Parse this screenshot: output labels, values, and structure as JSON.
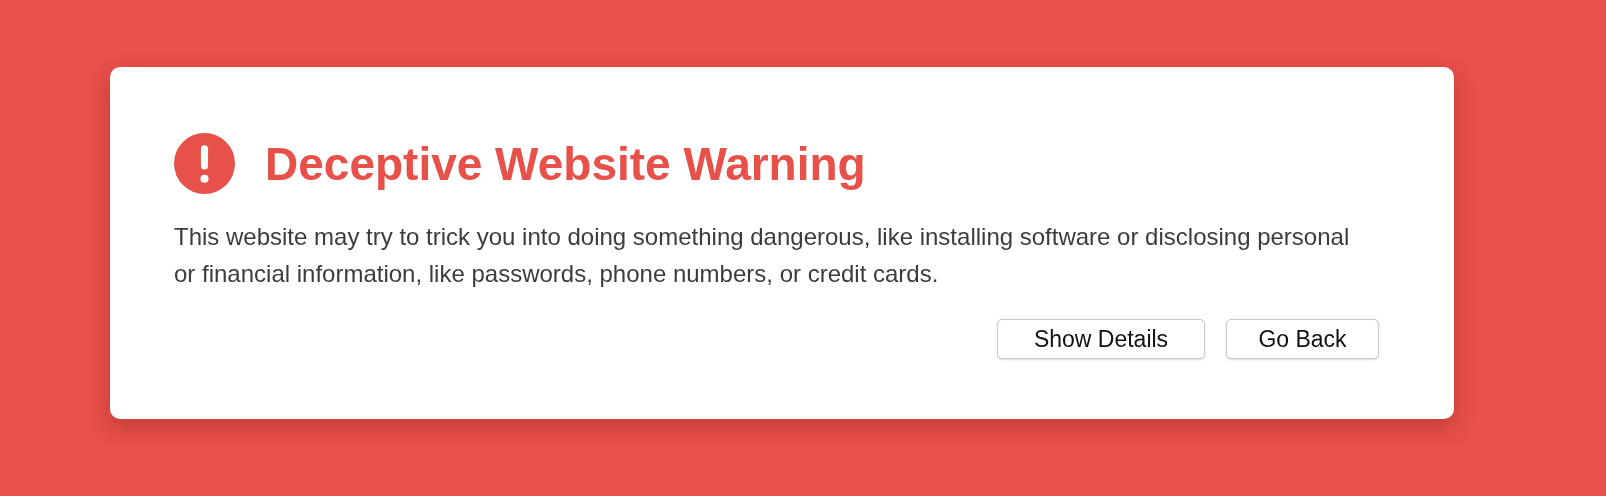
{
  "dialog": {
    "title": "Deceptive Website Warning",
    "message": "This website may try to trick you into doing something dangerous, like installing software or disclosing personal or financial information, like passwords, phone numbers, or credit cards.",
    "buttons": [
      "Show Details",
      "Go Back"
    ]
  }
}
